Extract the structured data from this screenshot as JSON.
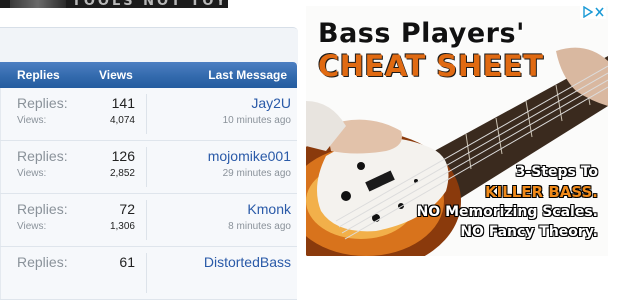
{
  "banner": {
    "text": "TOOLS NOT TOYS"
  },
  "forum": {
    "headers": {
      "replies": "Replies",
      "views": "Views",
      "last_message": "Last Message"
    },
    "threads": [
      {
        "replies_label": "Replies:",
        "replies": "141",
        "views_label": "Views:",
        "views": "4,074",
        "last_user": "Jay2U",
        "last_time": "10 minutes ago"
      },
      {
        "replies_label": "Replies:",
        "replies": "126",
        "views_label": "Views:",
        "views": "2,852",
        "last_user": "mojomike001",
        "last_time": "29 minutes ago"
      },
      {
        "replies_label": "Replies:",
        "replies": "72",
        "views_label": "Views:",
        "views": "1,306",
        "last_user": "Kmonk",
        "last_time": "8 minutes ago"
      },
      {
        "replies_label": "Replies:",
        "replies": "61",
        "views_label": "",
        "views": "",
        "last_user": "DistortedBass",
        "last_time": ""
      }
    ]
  },
  "ad": {
    "title_line1": "Bass Players'",
    "title_line2": "CHEAT SHEET",
    "line1": "3-Steps To",
    "line2": "KILLER BASS.",
    "line3": "NO Memorizing Scales.",
    "line4": "NO Fancy Theory.",
    "accent_color": "#e06a12",
    "adchoices_icons": [
      "adchoices-play-icon",
      "close-icon"
    ]
  }
}
